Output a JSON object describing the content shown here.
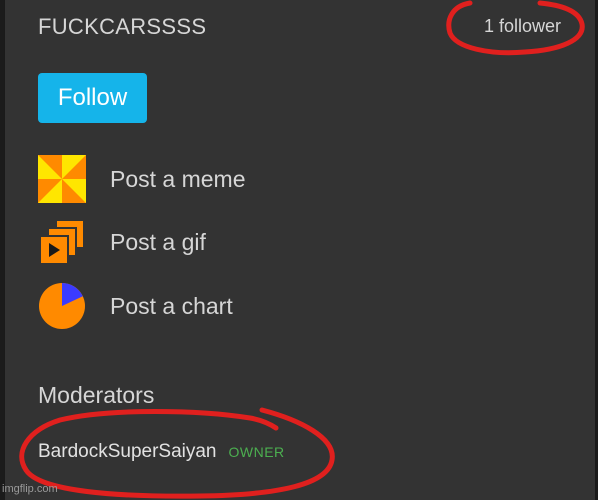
{
  "stream": {
    "title": "FUCKCARSSSS",
    "followers": "1 follower",
    "follow_label": "Follow"
  },
  "actions": [
    {
      "label": "Post a meme",
      "icon": "meme-pinwheel-icon"
    },
    {
      "label": "Post a gif",
      "icon": "gif-stack-play-icon"
    },
    {
      "label": "Post a chart",
      "icon": "pie-chart-icon"
    }
  ],
  "moderators": {
    "title": "Moderators",
    "list": [
      {
        "name": "BardockSuperSaiyan",
        "role": "OWNER"
      }
    ]
  },
  "watermark": "imgflip.com",
  "colors": {
    "panel_bg": "#333333",
    "follow_button": "#15b4ea",
    "owner_badge": "#4caf50",
    "annotation": "#e0201e",
    "icon_orange": "#ff8a00",
    "icon_yellow": "#ffe600",
    "icon_blue": "#3b3bff"
  }
}
